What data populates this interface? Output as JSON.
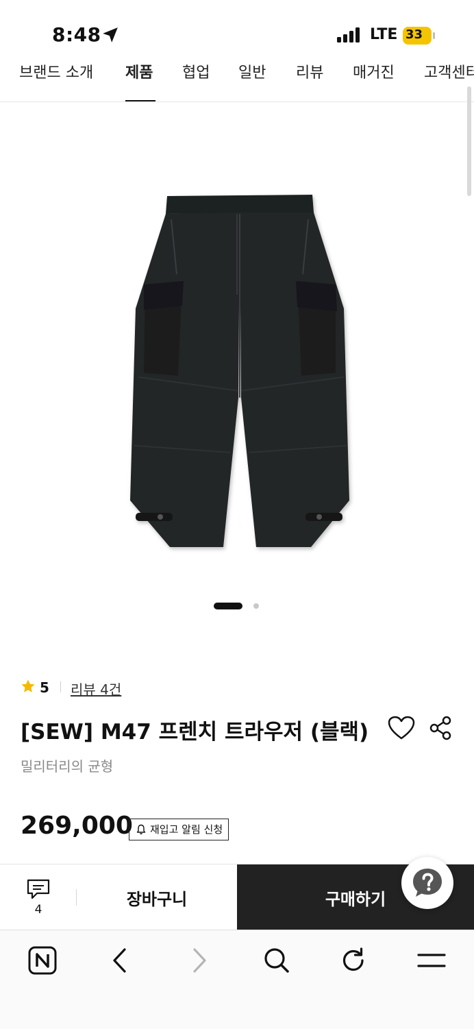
{
  "status": {
    "time": "8:48",
    "network": "LTE",
    "battery": "33"
  },
  "tabs": [
    {
      "label": "브랜드 소개"
    },
    {
      "label": "제품"
    },
    {
      "label": "협업"
    },
    {
      "label": "일반"
    },
    {
      "label": "리뷰"
    },
    {
      "label": "매거진"
    },
    {
      "label": "고객센터"
    }
  ],
  "product": {
    "rating": "5",
    "review_link": "리뷰 4건",
    "title": "[SEW] M47 프렌치 트라우저 (블랙)",
    "subtitle": "밀리터리의 균형",
    "price": "269,000",
    "restock_label": "재입고 알림 신청",
    "image_count": 2,
    "image_index": 1
  },
  "bottom_bar": {
    "comment_count": "4",
    "cart_label": "장바구니",
    "buy_label": "구매하기"
  },
  "colors": {
    "accent": "#f5b800",
    "buy_button": "#222222",
    "battery": "#f5c400"
  },
  "icons": [
    "location-arrow-icon",
    "signal-icon",
    "battery-icon",
    "star-icon",
    "heart-icon",
    "share-icon",
    "bell-icon",
    "comment-icon",
    "help-icon",
    "naver-icon",
    "back-icon",
    "forward-icon",
    "search-icon",
    "refresh-icon",
    "menu-icon"
  ]
}
